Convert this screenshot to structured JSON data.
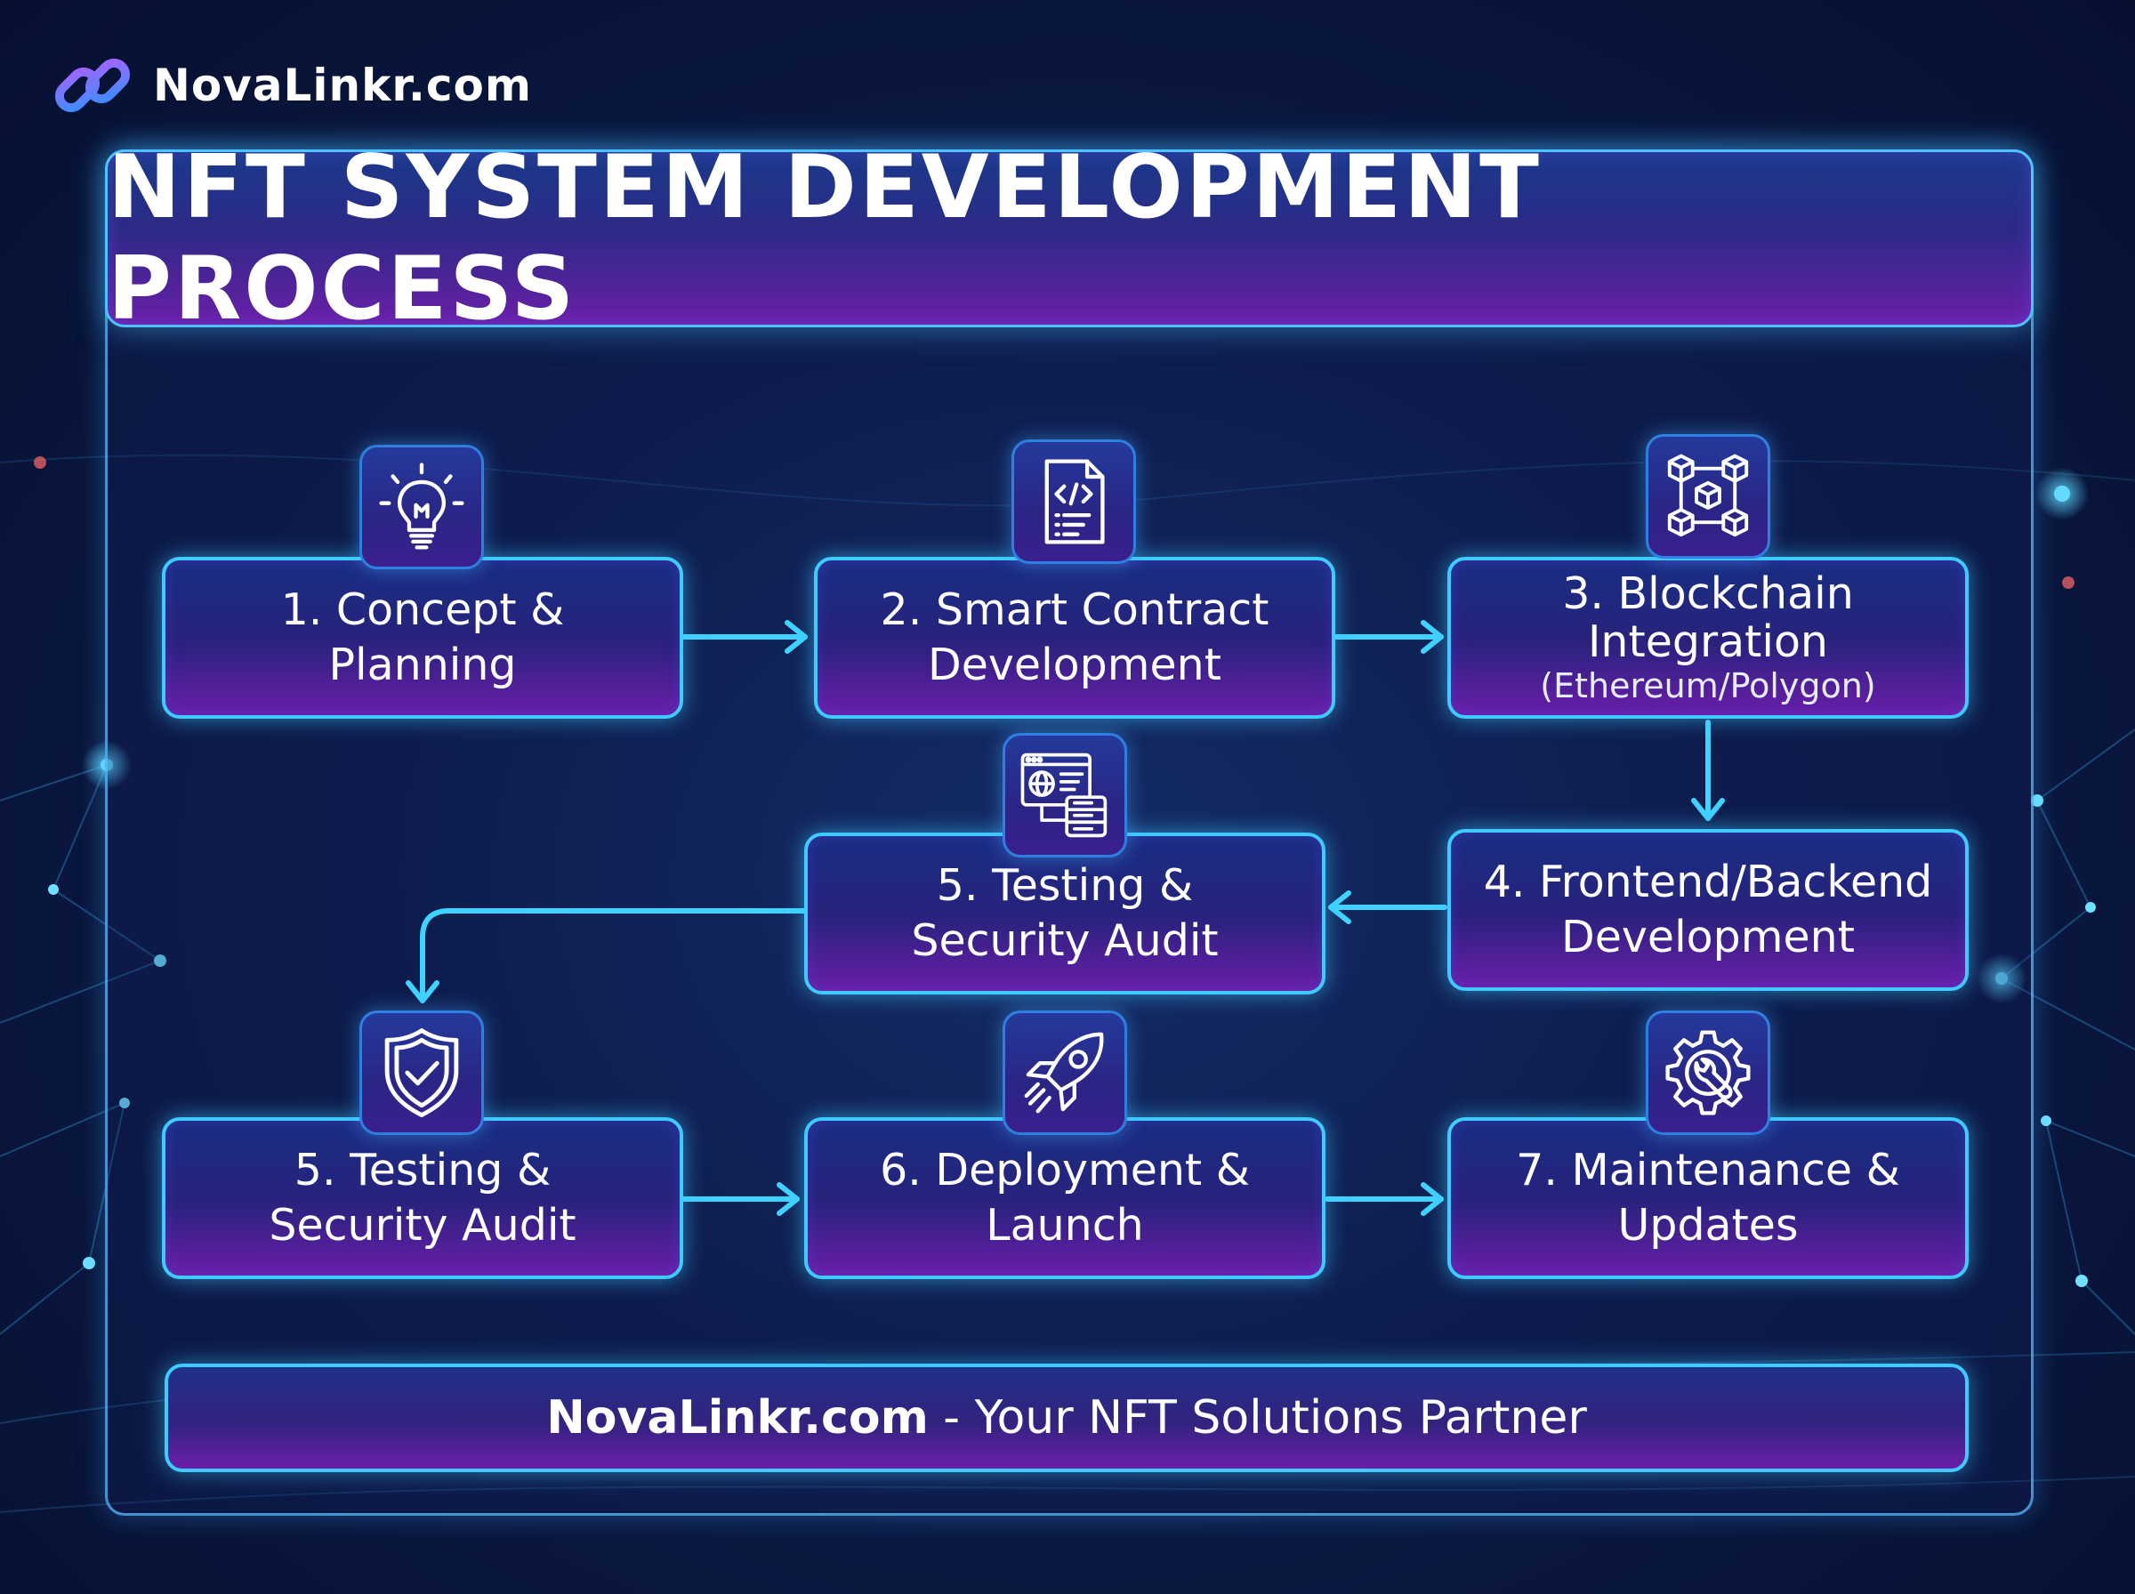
{
  "brand": {
    "name": "NovaLinkr.com"
  },
  "title": "NFT SYSTEM DEVELOPMENT PROCESS",
  "steps": [
    {
      "label": "1. Concept &\nPlanning",
      "sub": "",
      "icon": "lightbulb-icon"
    },
    {
      "label": "2. Smart Contract\nDevelopment",
      "sub": "",
      "icon": "code-document-icon"
    },
    {
      "label": "3. Blockchain\nIntegration",
      "sub": "(Ethereum/Polygon)",
      "icon": "blockchain-cubes-icon"
    },
    {
      "label": "4. Frontend/Backend\nDevelopment",
      "sub": ""
    },
    {
      "label": "5. Testing &\nSecurity Audit",
      "sub": "",
      "icon": "web-server-icon"
    },
    {
      "label": "5. Testing &\nSecurity Audit",
      "sub": "",
      "icon": "shield-check-icon"
    },
    {
      "label": "6. Deployment &\nLaunch",
      "sub": "",
      "icon": "rocket-icon"
    },
    {
      "label": "7. Maintenance &\nUpdates",
      "sub": "",
      "icon": "gear-wrench-icon"
    }
  ],
  "footer": {
    "brand": "NovaLinkr.com",
    "tagline": " - Your NFT Solutions Partner"
  },
  "colors": {
    "accent": "#3fcbff",
    "purple": "#6a1ea9",
    "navy": "#182e82"
  }
}
